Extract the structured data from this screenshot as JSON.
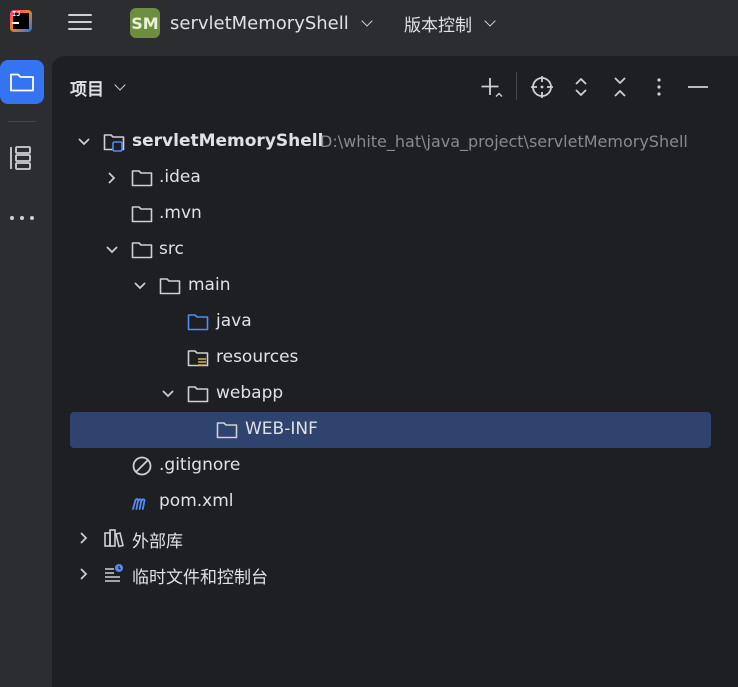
{
  "topbar": {
    "logo_text": "IJ",
    "project_badge": "SM",
    "project_name": "servletMemoryShell",
    "vcs_label": "版本控制"
  },
  "colors": {
    "background": "#2b2d30",
    "panel": "#1e1f22",
    "accent": "#3574f0",
    "selection": "#2e436e",
    "project_badge": "#6e8e3f",
    "text": "#dfe1e5",
    "muted_text": "#868a91"
  },
  "side_stripe": {
    "items": [
      {
        "icon": "folder-icon",
        "active": true
      },
      {
        "icon": "structure-icon",
        "active": false
      },
      {
        "icon": "more-icon",
        "active": false
      }
    ]
  },
  "panel": {
    "title": "项目",
    "toolbar": [
      {
        "icon": "add-icon"
      },
      {
        "icon": "locate-icon"
      },
      {
        "icon": "expand-all-icon"
      },
      {
        "icon": "collapse-all-icon"
      },
      {
        "icon": "more-vertical-icon"
      },
      {
        "icon": "minimize-icon"
      }
    ]
  },
  "tree": {
    "root": {
      "label": "servletMemoryShell",
      "path": "D:\\white_hat\\java_project\\servletMemoryShell"
    },
    "items": [
      {
        "label": ".idea"
      },
      {
        "label": ".mvn"
      },
      {
        "label": "src"
      },
      {
        "label": "main"
      },
      {
        "label": "java"
      },
      {
        "label": "resources"
      },
      {
        "label": "webapp"
      },
      {
        "label": "WEB-INF",
        "selected": true
      },
      {
        "label": ".gitignore"
      },
      {
        "label": "pom.xml"
      },
      {
        "label": "外部库"
      },
      {
        "label": "临时文件和控制台"
      }
    ]
  }
}
